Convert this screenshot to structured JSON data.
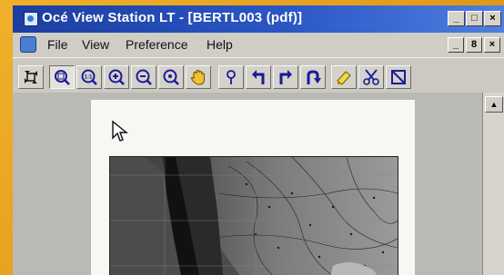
{
  "window": {
    "title": "Océ View Station LT - [BERTL003  (pdf)]",
    "controls": [
      "_",
      "□",
      "×"
    ]
  },
  "menubar": {
    "items": [
      "File",
      "View",
      "Preference",
      "Help"
    ],
    "mdi_controls": [
      "_",
      "8",
      "×"
    ]
  },
  "toolbar": {
    "buttons": [
      "fit-icon",
      "zoom-window-icon",
      "zoom-11-icon",
      "zoom-in-icon",
      "zoom-out-icon",
      "zoom-area-icon",
      "pan-hand-icon",
      "pin-icon",
      "rotate-left-icon",
      "rotate-right-icon",
      "rotate-180-icon",
      "highlight-icon",
      "scissors-icon",
      "select-region-icon"
    ],
    "zoom_11_label": "1:1"
  },
  "colors": {
    "titlebar": "#1c3ea0",
    "bezel": "#e8a21c",
    "icon_blue": "#1a1a9a"
  }
}
